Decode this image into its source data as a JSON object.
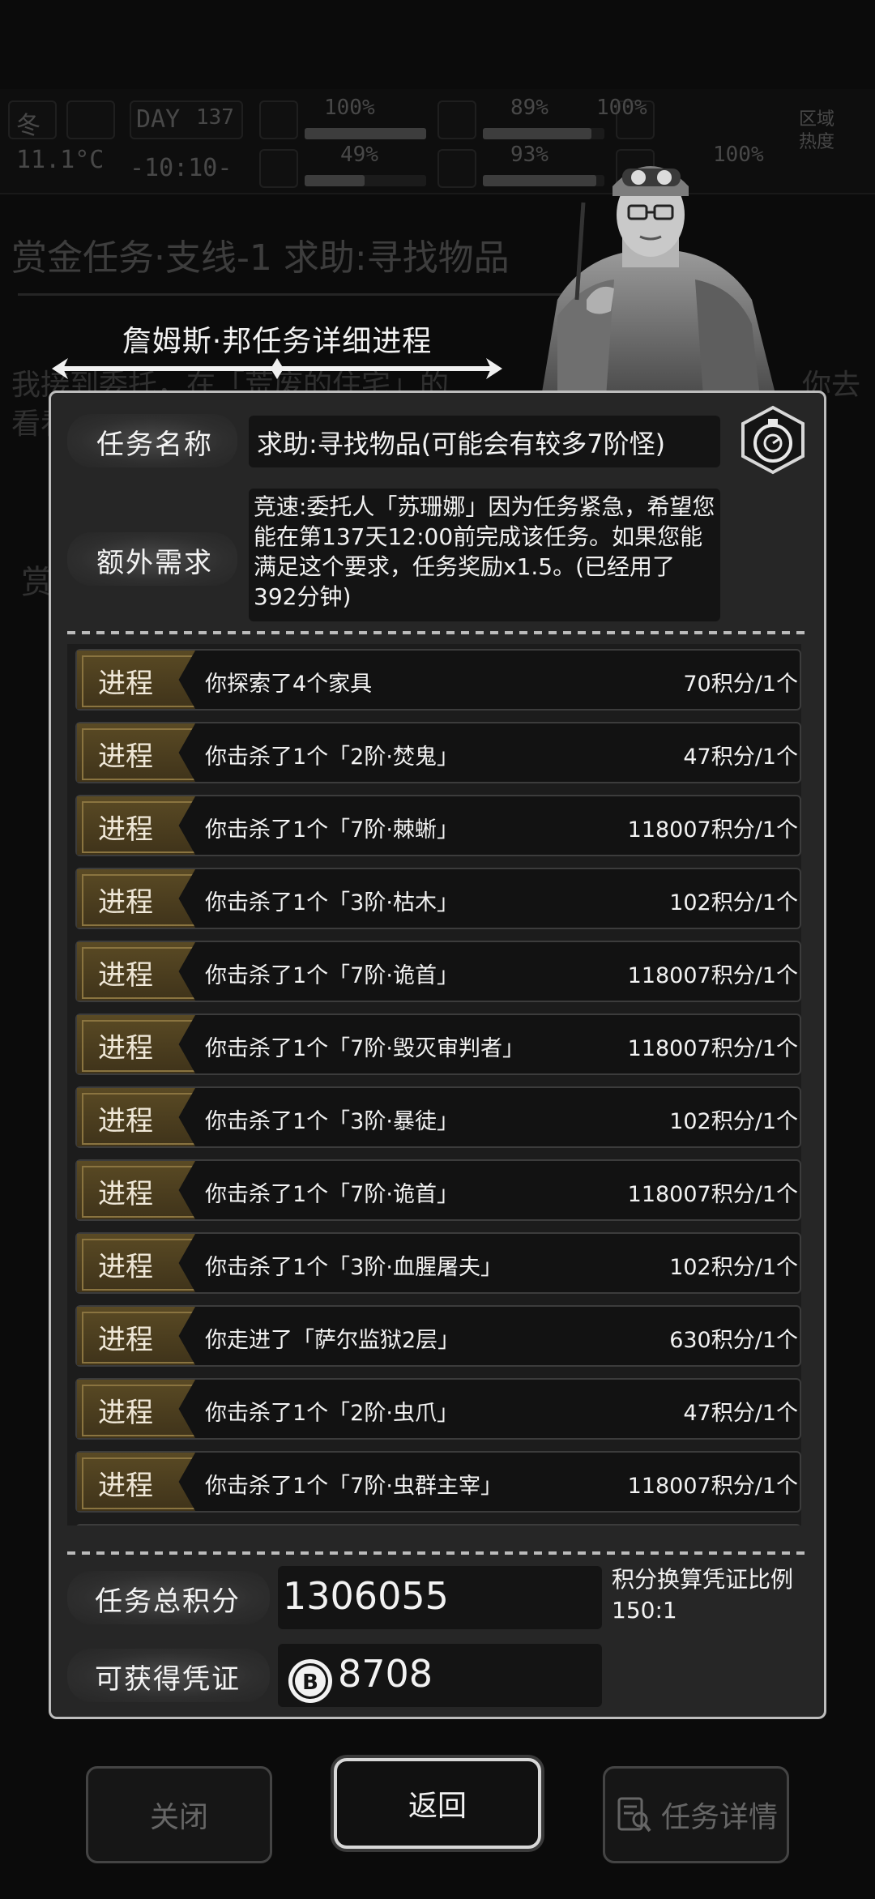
{
  "hud": {
    "season": "冬",
    "day_label": "DAY",
    "day_value": "137",
    "temperature": "11.1°C",
    "clock": "-10:10-",
    "stat_1": "100%",
    "stat_2": "89%",
    "stat_3": "100%",
    "stat_4": "49%",
    "stat_5": "93%",
    "stat_6": "100%",
    "zone_label": "区域热度"
  },
  "background": {
    "quest_title": "赏金任务·支线-1 求助:寻找物品",
    "frag_left": "我接到委托，在「荒废的住宅」的",
    "frag_right": "你去",
    "frag_left2": "看看",
    "frag_side": "赏"
  },
  "panel": {
    "title": "詹姆斯·邦任务详细进程",
    "name_label": "任务名称",
    "name_value": "求助:寻找物品(可能会有较多7阶怪)",
    "extra_label": "额外需求",
    "extra_value": "竞速:委托人「苏珊娜」因为任务紧急，希望您能在第137天12:00前完成该任务。如果您能满足这个要求，任务奖励x1.5。(已经用了392分钟)",
    "progress_tag": "进程",
    "progress": [
      {
        "desc": "你探索了4个家具",
        "score": "70积分/1个"
      },
      {
        "desc": "你击杀了1个「2阶·焚鬼」",
        "score": "47积分/1个"
      },
      {
        "desc": "你击杀了1个「7阶·棘蜥」",
        "score": "118007积分/1个"
      },
      {
        "desc": "你击杀了1个「3阶·枯木」",
        "score": "102积分/1个"
      },
      {
        "desc": "你击杀了1个「7阶·诡首」",
        "score": "118007积分/1个"
      },
      {
        "desc": "你击杀了1个「7阶·毁灭审判者」",
        "score": "118007积分/1个"
      },
      {
        "desc": "你击杀了1个「3阶·暴徒」",
        "score": "102积分/1个"
      },
      {
        "desc": "你击杀了1个「7阶·诡首」",
        "score": "118007积分/1个"
      },
      {
        "desc": "你击杀了1个「3阶·血腥屠夫」",
        "score": "102积分/1个"
      },
      {
        "desc": "你走进了「萨尔监狱2层」",
        "score": "630积分/1个"
      },
      {
        "desc": "你击杀了1个「2阶·虫爪」",
        "score": "47积分/1个"
      },
      {
        "desc": "你击杀了1个「7阶·虫群主宰」",
        "score": "118007积分/1个"
      }
    ],
    "total_label": "任务总积分",
    "total_value": "1306055",
    "ratio_label": "积分换算凭证比例",
    "ratio_value": "150:1",
    "voucher_label": "可获得凭证",
    "voucher_value": "8708"
  },
  "buttons": {
    "close": "关闭",
    "return": "返回",
    "details": "任务详情"
  },
  "icons": {
    "stopwatch": "stopwatch-icon",
    "coin": "bitcoin-coin-icon",
    "task_detail": "document-search-icon"
  }
}
